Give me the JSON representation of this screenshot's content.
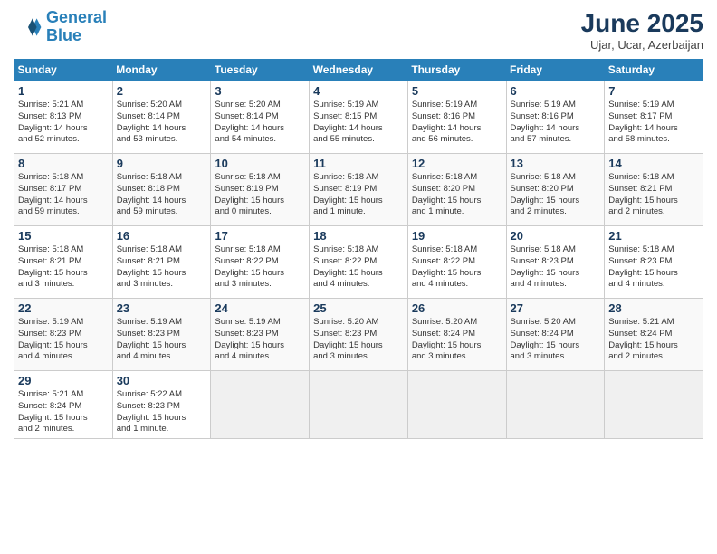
{
  "header": {
    "logo_line1": "General",
    "logo_line2": "Blue",
    "month": "June 2025",
    "location": "Ujar, Ucar, Azerbaijan"
  },
  "days_of_week": [
    "Sunday",
    "Monday",
    "Tuesday",
    "Wednesday",
    "Thursday",
    "Friday",
    "Saturday"
  ],
  "weeks": [
    [
      {
        "day": 1,
        "info": "Sunrise: 5:21 AM\nSunset: 8:13 PM\nDaylight: 14 hours\nand 52 minutes."
      },
      {
        "day": 2,
        "info": "Sunrise: 5:20 AM\nSunset: 8:14 PM\nDaylight: 14 hours\nand 53 minutes."
      },
      {
        "day": 3,
        "info": "Sunrise: 5:20 AM\nSunset: 8:14 PM\nDaylight: 14 hours\nand 54 minutes."
      },
      {
        "day": 4,
        "info": "Sunrise: 5:19 AM\nSunset: 8:15 PM\nDaylight: 14 hours\nand 55 minutes."
      },
      {
        "day": 5,
        "info": "Sunrise: 5:19 AM\nSunset: 8:16 PM\nDaylight: 14 hours\nand 56 minutes."
      },
      {
        "day": 6,
        "info": "Sunrise: 5:19 AM\nSunset: 8:16 PM\nDaylight: 14 hours\nand 57 minutes."
      },
      {
        "day": 7,
        "info": "Sunrise: 5:19 AM\nSunset: 8:17 PM\nDaylight: 14 hours\nand 58 minutes."
      }
    ],
    [
      {
        "day": 8,
        "info": "Sunrise: 5:18 AM\nSunset: 8:17 PM\nDaylight: 14 hours\nand 59 minutes."
      },
      {
        "day": 9,
        "info": "Sunrise: 5:18 AM\nSunset: 8:18 PM\nDaylight: 14 hours\nand 59 minutes."
      },
      {
        "day": 10,
        "info": "Sunrise: 5:18 AM\nSunset: 8:19 PM\nDaylight: 15 hours\nand 0 minutes."
      },
      {
        "day": 11,
        "info": "Sunrise: 5:18 AM\nSunset: 8:19 PM\nDaylight: 15 hours\nand 1 minute."
      },
      {
        "day": 12,
        "info": "Sunrise: 5:18 AM\nSunset: 8:20 PM\nDaylight: 15 hours\nand 1 minute."
      },
      {
        "day": 13,
        "info": "Sunrise: 5:18 AM\nSunset: 8:20 PM\nDaylight: 15 hours\nand 2 minutes."
      },
      {
        "day": 14,
        "info": "Sunrise: 5:18 AM\nSunset: 8:21 PM\nDaylight: 15 hours\nand 2 minutes."
      }
    ],
    [
      {
        "day": 15,
        "info": "Sunrise: 5:18 AM\nSunset: 8:21 PM\nDaylight: 15 hours\nand 3 minutes."
      },
      {
        "day": 16,
        "info": "Sunrise: 5:18 AM\nSunset: 8:21 PM\nDaylight: 15 hours\nand 3 minutes."
      },
      {
        "day": 17,
        "info": "Sunrise: 5:18 AM\nSunset: 8:22 PM\nDaylight: 15 hours\nand 3 minutes."
      },
      {
        "day": 18,
        "info": "Sunrise: 5:18 AM\nSunset: 8:22 PM\nDaylight: 15 hours\nand 4 minutes."
      },
      {
        "day": 19,
        "info": "Sunrise: 5:18 AM\nSunset: 8:22 PM\nDaylight: 15 hours\nand 4 minutes."
      },
      {
        "day": 20,
        "info": "Sunrise: 5:18 AM\nSunset: 8:23 PM\nDaylight: 15 hours\nand 4 minutes."
      },
      {
        "day": 21,
        "info": "Sunrise: 5:18 AM\nSunset: 8:23 PM\nDaylight: 15 hours\nand 4 minutes."
      }
    ],
    [
      {
        "day": 22,
        "info": "Sunrise: 5:19 AM\nSunset: 8:23 PM\nDaylight: 15 hours\nand 4 minutes."
      },
      {
        "day": 23,
        "info": "Sunrise: 5:19 AM\nSunset: 8:23 PM\nDaylight: 15 hours\nand 4 minutes."
      },
      {
        "day": 24,
        "info": "Sunrise: 5:19 AM\nSunset: 8:23 PM\nDaylight: 15 hours\nand 4 minutes."
      },
      {
        "day": 25,
        "info": "Sunrise: 5:20 AM\nSunset: 8:23 PM\nDaylight: 15 hours\nand 3 minutes."
      },
      {
        "day": 26,
        "info": "Sunrise: 5:20 AM\nSunset: 8:24 PM\nDaylight: 15 hours\nand 3 minutes."
      },
      {
        "day": 27,
        "info": "Sunrise: 5:20 AM\nSunset: 8:24 PM\nDaylight: 15 hours\nand 3 minutes."
      },
      {
        "day": 28,
        "info": "Sunrise: 5:21 AM\nSunset: 8:24 PM\nDaylight: 15 hours\nand 2 minutes."
      }
    ],
    [
      {
        "day": 29,
        "info": "Sunrise: 5:21 AM\nSunset: 8:24 PM\nDaylight: 15 hours\nand 2 minutes."
      },
      {
        "day": 30,
        "info": "Sunrise: 5:22 AM\nSunset: 8:23 PM\nDaylight: 15 hours\nand 1 minute."
      },
      null,
      null,
      null,
      null,
      null
    ]
  ]
}
